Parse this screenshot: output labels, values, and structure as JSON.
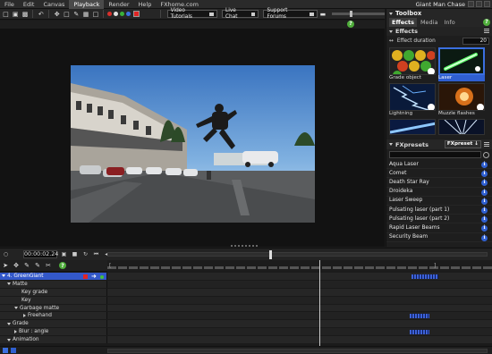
{
  "menu": {
    "items": [
      "File",
      "Edit",
      "Canvas",
      "Playback",
      "Render",
      "Help",
      "FXhome.com"
    ],
    "active": "Playback",
    "project_title": "Giant Man Chase"
  },
  "toolbar": {
    "video_tutorials": "Video Tutorials",
    "live_chat": "Live Chat",
    "support_forums": "Support Forums",
    "dot_colors": [
      "#d9302c",
      "#e0e0e0",
      "#3ab03a",
      "#3b6fe0"
    ],
    "swatch_color": "#e02424"
  },
  "toolbox": {
    "title": "Toolbox",
    "tabs": [
      "Effects",
      "Media",
      "Info"
    ],
    "active_tab": "Effects",
    "effects_header": "Effects",
    "duration_label": "Effect duration",
    "duration_value": "20",
    "tiles": [
      {
        "label": "Grade object",
        "selected": false
      },
      {
        "label": "Laser",
        "selected": true
      },
      {
        "label": "Lightning",
        "selected": false
      },
      {
        "label": "Muzzle flashes",
        "selected": false
      }
    ]
  },
  "fxpresets": {
    "title": "FXpresets",
    "button_label": "FXpreset",
    "items": [
      "Aqua Laser",
      "Comet",
      "Death Star Ray",
      "Droideka",
      "Laser Sweep",
      "Pulsating laser (part 1)",
      "Pulsating laser (part 2)",
      "Rapid Laser Beams",
      "Security Beam"
    ]
  },
  "transport": {
    "timecode": "00:00:02.24"
  },
  "timeline": {
    "tracks": [
      {
        "label": "4. GreenGiant",
        "indent": 0,
        "expander": "down",
        "selected": true,
        "dot": true
      },
      {
        "label": "Matte",
        "indent": 1,
        "expander": "down",
        "selected": false,
        "dot": false
      },
      {
        "label": "Key grade",
        "indent": 2,
        "expander": "none",
        "selected": false,
        "dot": false
      },
      {
        "label": "Key",
        "indent": 2,
        "expander": "none",
        "selected": false,
        "dot": false
      },
      {
        "label": "Garbage matte",
        "indent": 1,
        "expander": "down",
        "selected": false,
        "dot": false
      },
      {
        "label": "Freehand",
        "indent": 3,
        "expander": "right",
        "selected": false,
        "dot": true
      },
      {
        "label": "Grade",
        "indent": 1,
        "expander": "down",
        "selected": false,
        "dot": false
      },
      {
        "label": "Blur : angle",
        "indent": 2,
        "expander": "right",
        "selected": false,
        "dot": true
      },
      {
        "label": "Animation",
        "indent": 1,
        "expander": "down",
        "selected": false,
        "dot": false
      }
    ]
  }
}
